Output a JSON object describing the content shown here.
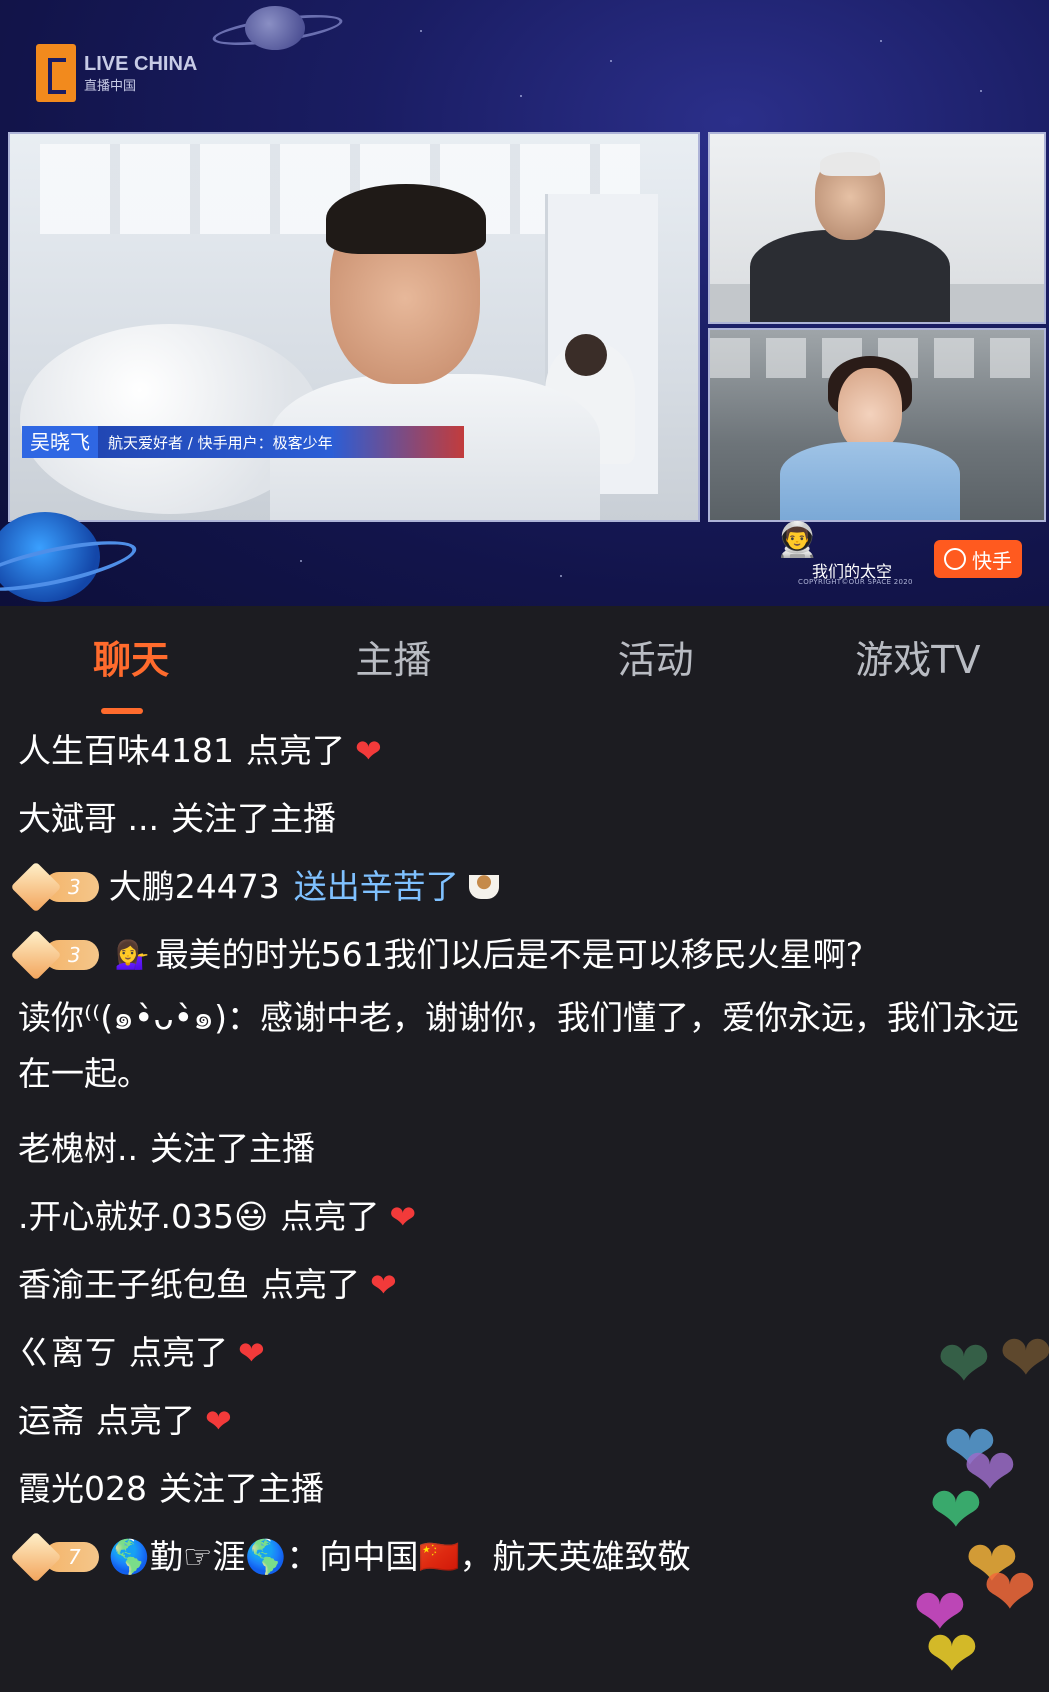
{
  "video": {
    "logo_text": "LIVE CHINA",
    "logo_sub": "直播中国",
    "guest_name": "吴晓飞",
    "guest_desc": "航天爱好者 / 快手用户：极客少年",
    "watermark_text": "我们的太空",
    "watermark_copyright": "COPYRIGHT©OUR SPACE 2020",
    "platform_label": "快手"
  },
  "tabs": [
    {
      "label": "聊天",
      "active": true
    },
    {
      "label": "主播",
      "active": false
    },
    {
      "label": "活动",
      "active": false
    },
    {
      "label": "游戏TV",
      "active": false
    }
  ],
  "chat": {
    "m1": {
      "user": "人生百味4181",
      "action": "点亮了"
    },
    "m2": {
      "user": "大斌哥 ...",
      "action": "关注了主播"
    },
    "m3": {
      "level": "3",
      "user": "大鹏24473",
      "action": "送出辛苦了"
    },
    "m4": {
      "level": "3",
      "emoji": "💁‍♀️",
      "user": "最美的时光561",
      "text": "我们以后是不是可以移民火星啊?"
    },
    "m5": {
      "user": "读你⁽⁽(๑•̀ᴗ•̀๑)",
      "text": "：感谢中老，谢谢你，我们懂了，爱你永远，我们永远在一起。"
    },
    "m6": {
      "user": "老槐树..",
      "action": "关注了主播"
    },
    "m7": {
      "user": ".开心就好.035😃",
      "action": "点亮了"
    },
    "m8": {
      "user": "香渝王子纸包鱼",
      "action": "点亮了"
    },
    "m9": {
      "user": "ㄍ离ㄎ",
      "action": "点亮了"
    },
    "m10": {
      "user": "运斋",
      "action": "点亮了"
    },
    "m11": {
      "user": "霞光028",
      "action": "关注了主播"
    },
    "m12": {
      "level": "7",
      "user": "🌎勤☞涯🌎",
      "text": "：向中国🇨🇳，航天英雄致敬"
    }
  },
  "colors": {
    "accent": "#ff6b2d",
    "heart": "#f23a3a",
    "gift": "#7fc1ff",
    "background": "#1c1c21"
  }
}
